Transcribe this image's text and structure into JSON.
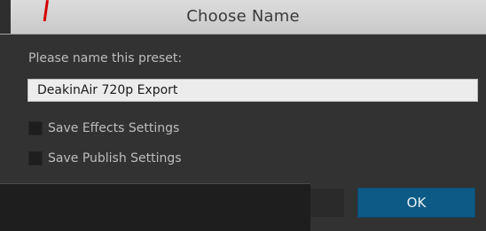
{
  "dialog": {
    "title": "Choose Name",
    "prompt": "Please name this preset:",
    "preset_name_value": "DeakinAir 720p Export",
    "options": [
      {
        "label": "Save Effects Settings",
        "checked": false
      },
      {
        "label": "Save Publish Settings",
        "checked": false
      }
    ],
    "ok_label": "OK"
  },
  "colors": {
    "accent_button": "#0e5a86",
    "dialog_background": "#323232",
    "titlebar_background": "#d4d4d4",
    "marker_red": "#d40000"
  }
}
